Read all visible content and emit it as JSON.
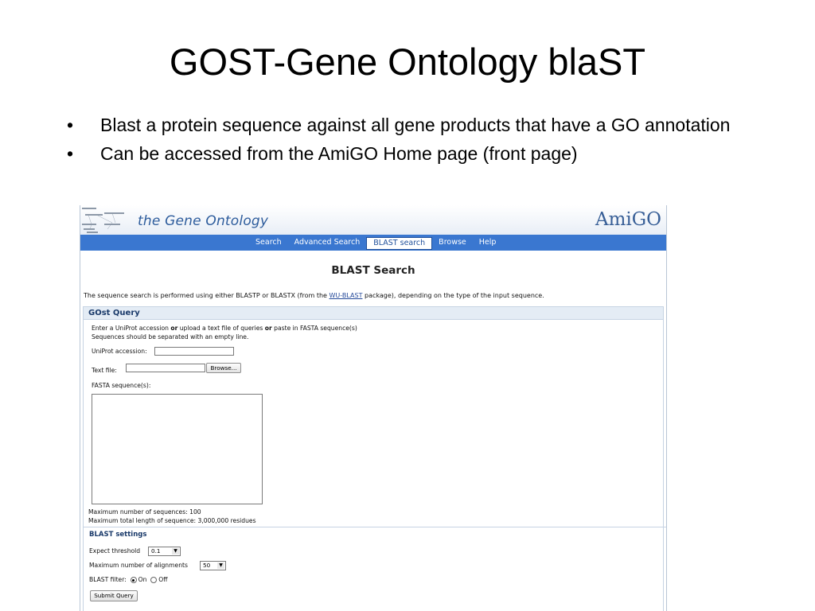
{
  "slide": {
    "title": "GOST-Gene Ontology blaST",
    "bullets": [
      "Blast a protein sequence against all gene products that have a GO annotation",
      "Can be accessed from the AmiGO Home page (front page)"
    ],
    "bullet_char": "•"
  },
  "screenshot": {
    "header": {
      "site_title": "the Gene Ontology",
      "logo_text": "AmiGO"
    },
    "nav": [
      {
        "label": "Search"
      },
      {
        "label": "Advanced Search"
      },
      {
        "label": "BLAST search",
        "active": true
      },
      {
        "label": "Browse"
      },
      {
        "label": "Help"
      }
    ],
    "page_title": "BLAST Search",
    "intro": {
      "before": "The sequence search is performed using either BLASTP or BLASTX (from the ",
      "link": "WU-BLAST",
      "after": " package), depending on the type of the input sequence."
    },
    "query": {
      "heading": "GOst Query",
      "instr_line1_a": "Enter a UniProt accession ",
      "instr_or1": "or",
      "instr_line1_b": " upload a text file of queries ",
      "instr_or2": "or",
      "instr_line1_c": " paste in FASTA sequence(s)",
      "instr_line2": "Sequences should be separated with an empty line.",
      "uniprot_label": "UniProt accession:",
      "uniprot_value": "",
      "textfile_label": "Text file:",
      "browse_label": "Browse...",
      "fasta_label": "FASTA sequence(s):",
      "fasta_value": "",
      "max_seqs": "Maximum number of sequences: 100",
      "max_length": "Maximum total length of sequence: 3,000,000 residues"
    },
    "settings": {
      "heading": "BLAST settings",
      "expect_label": "Expect threshold",
      "expect_value": "0.1",
      "alignments_label": "Maximum number of alignments",
      "alignments_value": "50",
      "filter_label": "BLAST filter:",
      "filter_on": "On",
      "filter_off": "Off",
      "filter_selected": "On",
      "submit_label": "Submit Query"
    },
    "colors": {
      "nav_bg": "#3a77d0",
      "link": "#24499a",
      "panel_header": "#e4ecf5",
      "title_blue": "#2d5c9c"
    }
  }
}
